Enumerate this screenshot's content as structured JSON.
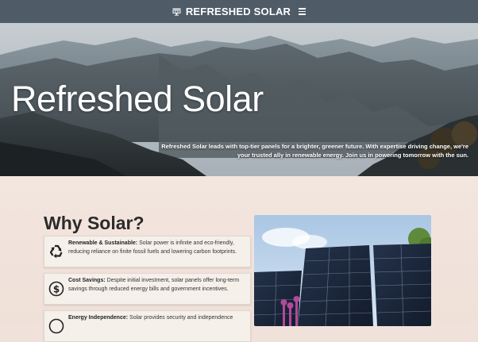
{
  "header": {
    "brand": "REFRESHED SOLAR",
    "brand_icon": "solar-panel-icon",
    "menu_icon": "hamburger-menu-icon"
  },
  "hero": {
    "title": "Refreshed Solar",
    "text": "Refreshed Solar leads with top-tier panels for a brighter, greener future. With expertise driving change, we're your trusted ally in renewable energy. Join us in powering tomorrow with the sun."
  },
  "why": {
    "title": "Why Solar?",
    "items": [
      {
        "heading": "Renewable & Sustainable:",
        "body": " Solar power is infinite and eco-friendly, reducing reliance on finite fossil fuels and lowering carbon footprints.",
        "icon": "recycle-icon"
      },
      {
        "heading": "Cost Savings:",
        "body": " Despite initial investment, solar panels offer long-term savings through reduced energy bills and government incentives.",
        "icon": "dollar-coin-icon"
      },
      {
        "heading": "Energy Independence:",
        "body": " Solar provides security and independence",
        "icon": "energy-independence-icon"
      }
    ]
  },
  "colors": {
    "topbar": "#4f5b67",
    "content_bg": "#f0e2da",
    "card_bg": "#f5f0ea"
  }
}
